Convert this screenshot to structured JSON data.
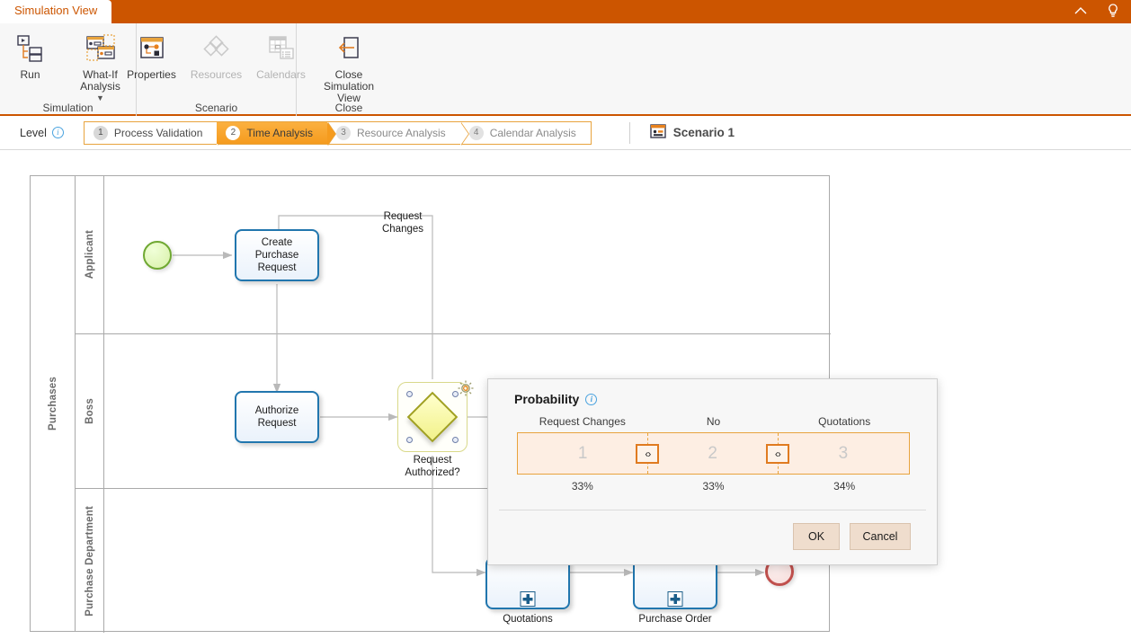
{
  "titlebar": {
    "tab_label": "Simulation View",
    "icons": [
      {
        "name": "collapse-ribbon-icon",
        "glyph": "chevron-up"
      },
      {
        "name": "help-lightbulb-icon",
        "glyph": "lightbulb"
      }
    ],
    "accent_color": "#CC5500"
  },
  "ribbon": {
    "groups": [
      {
        "title": "Simulation",
        "items": [
          {
            "label": "Run",
            "icon": "run-icon",
            "disabled": false,
            "has_dropdown": false
          },
          {
            "label": "What-If Analysis",
            "icon": "what-if-analysis-icon",
            "disabled": false,
            "has_dropdown": true
          }
        ]
      },
      {
        "title": "Scenario",
        "items": [
          {
            "label": "Properties",
            "icon": "properties-icon",
            "disabled": false,
            "has_dropdown": false
          },
          {
            "label": "Resources",
            "icon": "resources-icon",
            "disabled": true,
            "has_dropdown": false
          },
          {
            "label": "Calendars",
            "icon": "calendars-icon",
            "disabled": true,
            "has_dropdown": false
          }
        ]
      },
      {
        "title": "Close",
        "items": [
          {
            "label": "Close\nSimulation View",
            "icon": "close-simulation-view-icon",
            "disabled": false,
            "has_dropdown": false
          }
        ]
      }
    ]
  },
  "levelbar": {
    "label": "Level",
    "steps": [
      {
        "num": "1",
        "label": "Process Validation",
        "active": false
      },
      {
        "num": "2",
        "label": "Time Analysis",
        "active": true
      },
      {
        "num": "3",
        "label": "Resource Analysis",
        "active": false
      },
      {
        "num": "4",
        "label": "Calendar Analysis",
        "active": false
      }
    ],
    "scenario_label": "Scenario 1",
    "active_color": "#F59B1E"
  },
  "diagram": {
    "pool_label": "Purchases",
    "lanes": [
      {
        "label": "Applicant"
      },
      {
        "label": "Boss"
      },
      {
        "label": "Purchase Department"
      }
    ],
    "nodes": [
      {
        "id": "start",
        "type": "start-event",
        "label": ""
      },
      {
        "id": "create_purchase_request",
        "type": "task",
        "label": "Create\nPurchase\nRequest"
      },
      {
        "id": "authorize_request",
        "type": "task",
        "label": "Authorize\nRequest"
      },
      {
        "id": "request_authorized",
        "type": "gateway",
        "label": "Request\nAuthorized?",
        "selected": true
      },
      {
        "id": "quotations",
        "type": "sub-process",
        "label": "Quotations"
      },
      {
        "id": "purchase_order",
        "type": "sub-process",
        "label": "Purchase Order"
      },
      {
        "id": "end",
        "type": "end-event",
        "label": ""
      }
    ],
    "flow_labels": [
      {
        "id": "request_changes",
        "text": "Request\nChanges"
      }
    ]
  },
  "dialog": {
    "title": "Probability",
    "segments": [
      {
        "label": "Request Changes",
        "index": "1",
        "percent": "33%"
      },
      {
        "label": "No",
        "index": "2",
        "percent": "33%"
      },
      {
        "label": "Quotations",
        "index": "3",
        "percent": "34%"
      }
    ],
    "handles": [
      {
        "name": "probability-handle-1",
        "glyph": "‹›"
      },
      {
        "name": "probability-handle-2",
        "glyph": "‹›"
      }
    ],
    "ok_label": "OK",
    "cancel_label": "Cancel"
  }
}
